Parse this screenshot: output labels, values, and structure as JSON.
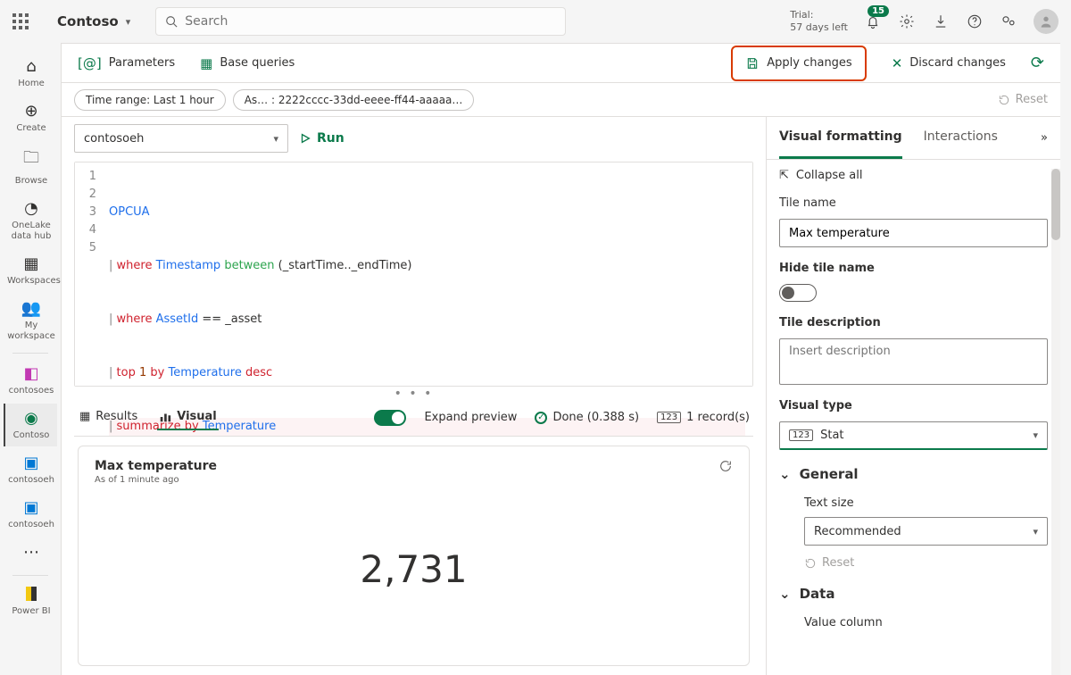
{
  "top": {
    "brand": "Contoso",
    "search_placeholder": "Search",
    "trial_line1": "Trial:",
    "trial_line2": "57 days left",
    "notif_count": "15"
  },
  "nav": {
    "home": "Home",
    "create": "Create",
    "browse": "Browse",
    "onelake": "OneLake data hub",
    "workspaces": "Workspaces",
    "myws": "My workspace",
    "contosoes": "contosoes",
    "contoso": "Contoso",
    "contosoeh1": "contosoeh",
    "contosoeh2": "contosoeh",
    "powerbi": "Power BI"
  },
  "toolbar": {
    "parameters": "Parameters",
    "base_queries": "Base queries",
    "apply": "Apply changes",
    "discard": "Discard changes"
  },
  "filters": {
    "time": "Time range: Last 1 hour",
    "asset": "As… : 2222cccc-33dd-eeee-ff44-aaaaa…",
    "reset": "Reset"
  },
  "ds": {
    "selected": "contosoeh",
    "run": "Run"
  },
  "code": {
    "l1": "OPCUA",
    "l2_where": "where",
    "l2_field": "Timestamp",
    "l2_between": "between",
    "l2_args": "(_startTime.._endTime)",
    "l3_where": "where",
    "l3_field": "AssetId",
    "l3_eq": "==",
    "l3_val": "_asset",
    "l4_top": "top",
    "l4_n": "1",
    "l4_by": "by",
    "l4_field": "Temperature",
    "l4_desc": "desc",
    "l5_sum": "summarize",
    "l5_by": "by",
    "l5_field": "Temperature"
  },
  "results": {
    "tab_results": "Results",
    "tab_visual": "Visual",
    "expand": "Expand preview",
    "done": "Done (0.388 s)",
    "records": "1 record(s)"
  },
  "visual": {
    "title": "Max temperature",
    "sub": "As of 1 minute ago",
    "value": "2,731"
  },
  "panel": {
    "tab_vf": "Visual formatting",
    "tab_int": "Interactions",
    "collapse": "Collapse all",
    "tile_name_label": "Tile name",
    "tile_name_value": "Max temperature",
    "hide_label": "Hide tile name",
    "desc_label": "Tile description",
    "desc_placeholder": "Insert description",
    "vtype_label": "Visual type",
    "vtype_value": "Stat",
    "general": "General",
    "textsize_label": "Text size",
    "textsize_value": "Recommended",
    "reset": "Reset",
    "data": "Data",
    "value_col": "Value column"
  }
}
